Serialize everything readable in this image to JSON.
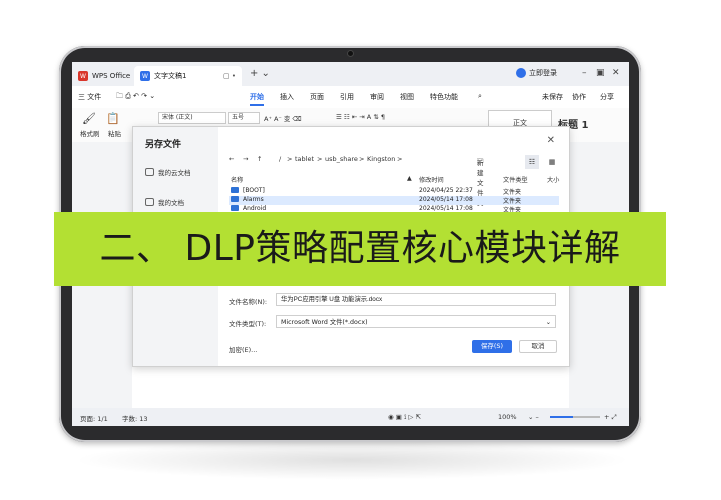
{
  "app": {
    "wps_tab": "WPS Office",
    "doc_tab": "文字文稿1",
    "login": "立即登录"
  },
  "menu": {
    "file": "三 文件",
    "items": [
      "开始",
      "插入",
      "页面",
      "引用",
      "审阅",
      "视图",
      "特色功能"
    ],
    "right": [
      "未保存",
      "协作",
      "分享"
    ]
  },
  "ribbon": {
    "format_brush": "格式刷",
    "paste": "粘贴",
    "font": "宋体 (正文)",
    "size": "五号",
    "style_normal": "正文",
    "style_h1": "标题 1"
  },
  "dialog": {
    "title": "另存文件",
    "locations": [
      "我的云文档",
      "我的文档"
    ],
    "path": [
      "/",
      "tablet",
      "usb_share",
      "Kingston"
    ],
    "new_folder": "新建文件夹",
    "columns": {
      "name": "名称",
      "modified": "修改时间",
      "type": "文件类型",
      "size": "大小"
    },
    "rows": [
      {
        "name": "[BOOT]",
        "modified": "2024/04/25 22:37",
        "type": "文件夹"
      },
      {
        "name": "Alarms",
        "modified": "2024/05/14 17:08",
        "type": "文件夹"
      },
      {
        "name": "Android",
        "modified": "2024/05/14 17:08",
        "type": "文件夹"
      }
    ],
    "filename_label": "文件名称(N):",
    "filename_value": "华为PC应用引擎 U盘 功能演示.docx",
    "filetype_label": "文件类型(T):",
    "filetype_value": "Microsoft Word 文件(*.docx)",
    "encrypt": "加密(E)...",
    "save": "保存(S)",
    "cancel": "取消"
  },
  "status": {
    "page": "页面: 1/1",
    "words": "字数: 13",
    "zoom": "100%",
    "zoom_level": 0.45
  },
  "banner": {
    "text": "二、 DLP策略配置核心模块详解",
    "color": "#b3e033"
  }
}
